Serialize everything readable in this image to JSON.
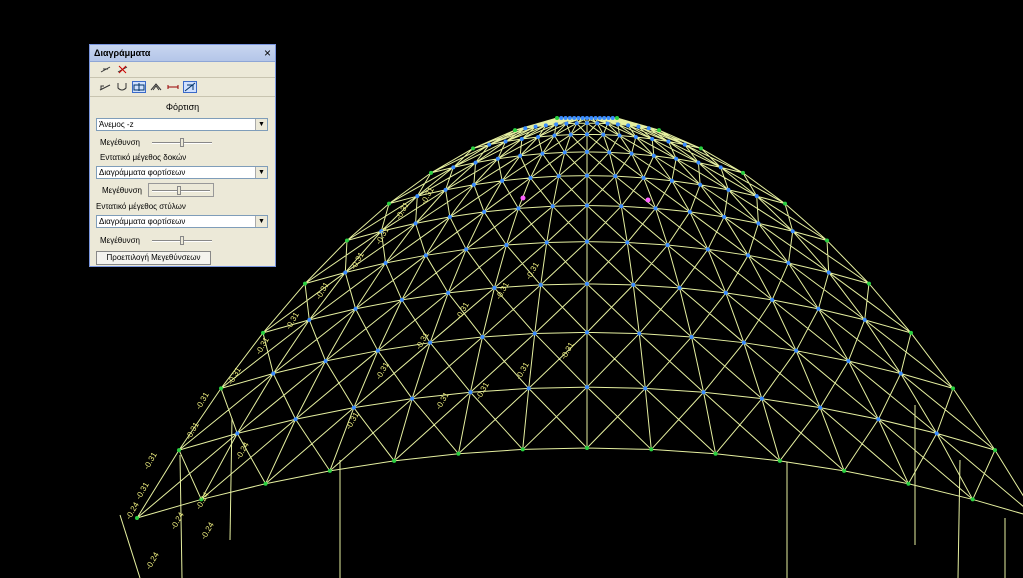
{
  "panel": {
    "title": "Διαγράμματα",
    "close_symbol": "×",
    "loads_label": "Φόρτιση",
    "loads_value": "Άνεμος -z",
    "magnification_1": "Μεγέθυνση",
    "beams_label": "Εντατικό μέγεθος δοκών",
    "beams_value": "Διαγράμματα φορτίσεων",
    "magnification_2": "Μεγέθυνση",
    "columns_label": "Εντατικό μέγεθος στύλων",
    "columns_value": "Διαγράμματα φορτίσεων",
    "magnification_3": "Μεγέθυνση",
    "preset_button": "Προεπιλογή Μεγεθύνσεων",
    "slider_levels": [
      0.5,
      0.5,
      0.5
    ]
  },
  "model": {
    "value_labels": [
      "-0.31",
      "-0.24"
    ],
    "colors": {
      "background": "#000000",
      "frame": "#e6f0a0",
      "diagram": "#f0f080",
      "node": "#3a8cff",
      "support": "#2ad040",
      "highlight": "#ff60ff"
    }
  }
}
